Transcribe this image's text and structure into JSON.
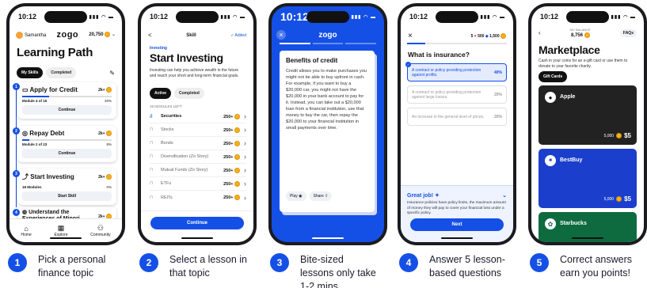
{
  "status_time": "10:12",
  "phone1": {
    "user": "Samantha",
    "logo": "zogo",
    "points": "20,750",
    "title": "Learning Path",
    "tabs": [
      "My Skills",
      "Completed"
    ],
    "cards": [
      {
        "num": "1",
        "title": "Apply for Credit",
        "points": "2k+",
        "progress_label": "Module 4 of 15",
        "percent": "30%",
        "progress": 0.3,
        "button": "Continue"
      },
      {
        "num": "2",
        "title": "Repay Debt",
        "points": "2k+",
        "progress_label": "Module 2 of 23",
        "percent": "8%",
        "progress": 0.08,
        "button": "Continue"
      },
      {
        "num": "3",
        "title": "Start Investing",
        "points": "2k+",
        "progress_label": "18 Modules",
        "percent": "0%",
        "progress": 0,
        "button": "Start Skill"
      },
      {
        "num": "4",
        "title": "Understand the Experiences of Minori...",
        "points": "2k+"
      }
    ],
    "nav": [
      "Home",
      "Explore",
      "Community"
    ]
  },
  "phone2": {
    "back": "<",
    "header": "Skill",
    "added": "✓ Added",
    "kicker": "Investing",
    "title": "Start Investing",
    "desc": "Investing can help you achieve wealth in the future and reach your short and long-term financial goals.",
    "tabs": [
      "Active",
      "Completed"
    ],
    "left_label": "15 MODULES LEFT",
    "lessons": [
      {
        "name": "Securities",
        "points": "250+"
      },
      {
        "name": "Stocks",
        "points": "250+"
      },
      {
        "name": "Bonds",
        "points": "250+"
      },
      {
        "name": "Diversification (Zo Story)",
        "points": "250+"
      },
      {
        "name": "Mutual Funds (Zo Story)",
        "points": "250+"
      },
      {
        "name": "ETFs",
        "points": "250+"
      },
      {
        "name": "REITs",
        "points": "250+"
      }
    ],
    "button": "Continue"
  },
  "phone3": {
    "logo": "zogo",
    "close": "×",
    "title": "Benefits of credit",
    "body": "Credit allows you to make purchases you might not be able to buy upfront in cash. For example, if you want to buy a $20,000 car, you might not have the $20,000 in your bank account to pay for it. Instead, you can take out a $20,000 loan from a financial institution, use that money to buy the car, then repay the $20,000 to your financial institution in small payments over time.",
    "play": "Play",
    "share": "Share"
  },
  "phone4": {
    "close": "×",
    "lives": "5",
    "gems": "500",
    "points": "1,500",
    "question": "What is insurance?",
    "answers": [
      {
        "text": "A contract or policy providing protection against profits.",
        "pct": "40%",
        "value": 0.4
      },
      {
        "text": "A contract or policy providing protection against large losses.",
        "pct": "20%",
        "value": 0.2
      },
      {
        "text": "An increase in the general level of prices.",
        "pct": "20%",
        "value": 0.2
      }
    ],
    "feedback_title": "Great job!",
    "feedback_body": "Insurance policies have policy limits, the maximum amount of money they will pay to cover your financial loss under a specific policy.",
    "button": "Next"
  },
  "phone5": {
    "balance_label": "MY BALANCE",
    "balance": "8,756",
    "faqs": "FAQs",
    "title": "Marketplace",
    "desc": "Cash in your coins for an e-gift card or use them to donate to your favorite charity.",
    "chip": "Gift Cards",
    "cards": [
      {
        "name": "Apple",
        "cost": "5,000",
        "price": "$5",
        "color": "#222222"
      },
      {
        "name": "BestBuy",
        "cost": "5,000",
        "price": "$5",
        "color": "#1b3fcc"
      },
      {
        "name": "Starbucks",
        "color": "#0d6b3f"
      }
    ]
  },
  "captions": [
    {
      "num": "1",
      "text": "Pick a personal finance topic"
    },
    {
      "num": "2",
      "text": "Select a lesson in that topic"
    },
    {
      "num": "3",
      "text": "Bite-sized lessons only take 1-2 mins"
    },
    {
      "num": "4",
      "text": "Answer 5 lesson-based questions"
    },
    {
      "num": "5",
      "text": "Correct answers earn you points!"
    }
  ],
  "colors": {
    "brand": "#1550e6",
    "coin": "#f6b21b",
    "success": "#2b9348"
  }
}
